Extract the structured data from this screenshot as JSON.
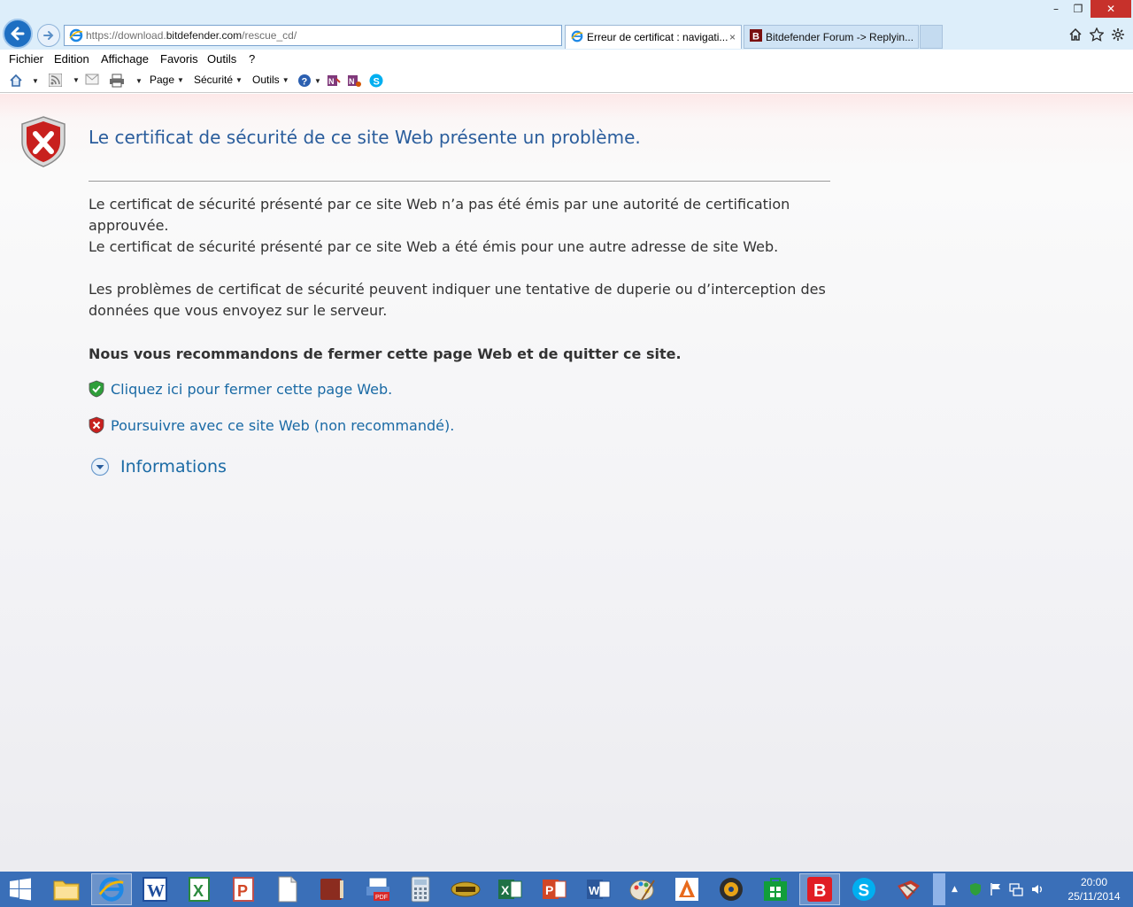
{
  "browser": {
    "url_prefix": "https://download.",
    "url_host": "bitdefender.com",
    "url_path": "/rescue_cd/",
    "tabs": [
      {
        "title": "Erreur de certificat : navigati...",
        "active": true
      },
      {
        "title": "Bitdefender Forum -> Replyin...",
        "active": false
      }
    ],
    "tab_close": "×",
    "window_controls": {
      "minimize": "–",
      "restore": "❐",
      "close": "✕"
    }
  },
  "menu": {
    "items": [
      "Fichier",
      "Edition",
      "Affichage",
      "Favoris",
      "Outils",
      "?"
    ]
  },
  "commandbar": {
    "page_label": "Page",
    "security_label": "Sécurité",
    "tools_label": "Outils"
  },
  "error_page": {
    "title": "Le certificat de sécurité de ce site Web présente un problème.",
    "para1": "Le certificat de sécurité présenté par ce site Web n’a pas été émis par une autorité de certification approuvée.",
    "para2": "Le certificat de sécurité présenté par ce site Web a été émis pour une autre adresse de site Web.",
    "para3": "Les problèmes de certificat de sécurité peuvent indiquer une tentative de duperie ou d’interception des données que vous envoyez sur le serveur.",
    "recommendation": "Nous vous recommandons de fermer cette page Web et de quitter ce site.",
    "close_link": "Cliquez ici pour fermer cette page Web.",
    "continue_link": "Poursuivre avec ce site Web (non recommandé).",
    "more_info": "Informations"
  },
  "taskbar": {
    "time": "20:00",
    "date": "25/11/2014",
    "pinned_apps": [
      "file-explorer",
      "internet-explorer",
      "word-2003",
      "excel-2003",
      "powerpoint-2003",
      "blank-document",
      "book",
      "pdf-printer",
      "calculator",
      "game",
      "excel",
      "powerpoint",
      "word",
      "paint",
      "phoenix-app",
      "media-player",
      "store",
      "bitdefender",
      "skype",
      "toolbox"
    ]
  },
  "colors": {
    "link": "#1a6aa5",
    "title": "#2a5d9c",
    "taskbar": "#3a6fb8",
    "close_button": "#c7312b"
  }
}
